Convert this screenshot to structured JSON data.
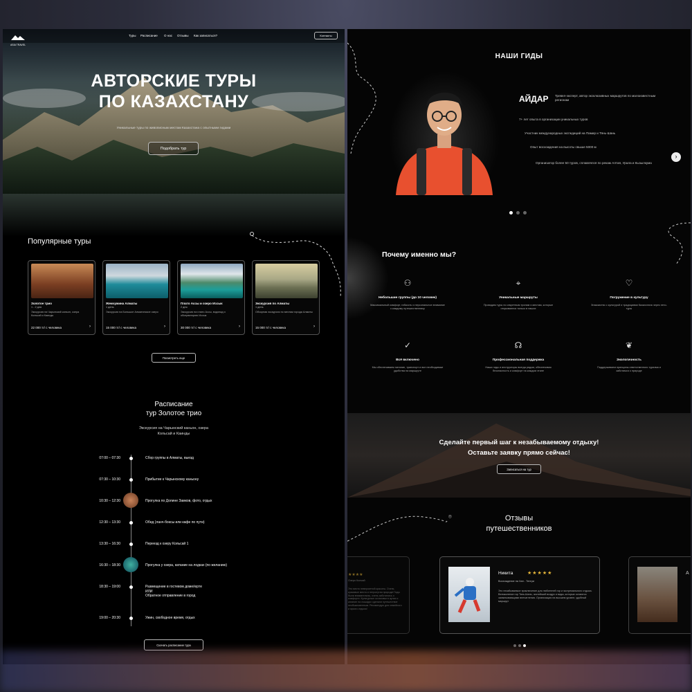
{
  "brand": {
    "name": "ASIA TRAVEL"
  },
  "nav": {
    "items": [
      "Туры",
      "Расписание",
      "О нас",
      "Отзывы",
      "Как записаться?"
    ],
    "contacts": "Контакты"
  },
  "hero": {
    "title_line1": "АВТОРСКИЕ ТУРЫ",
    "title_line2": "ПО КАЗАХСТАНУ",
    "subtitle": "Уникальные туры по живописным местам Казахстана с опытными гидами",
    "cta": "Подобрать тур"
  },
  "popular": {
    "title": "Популярные туры",
    "more": "Посмотреть еще",
    "cards": [
      {
        "title": "Золотое трио",
        "duration": "1 - 2 дня",
        "desc": "Экскурсия на Чарынский каньон, озера Кольсай и Каинды",
        "price": "22 000 тг/ с человека"
      },
      {
        "title": "Жемчужина Алматы",
        "duration": "1 день",
        "desc": "Экскурсия на Большое Алматинское озеро",
        "price": "15 000 тг/ с человека"
      },
      {
        "title": "Плато Ассы и озеро Иссык",
        "duration": "2 дня",
        "desc": "Экскурсия на плато Ассы, водопад и обсерваторию Иссык",
        "price": "30 000 тг/ с человека"
      },
      {
        "title": "Экскурсия по Алматы",
        "duration": "1 день",
        "desc": "Обзорная экскурсия по местам города Алматы",
        "price": "15 000 тг/ с человека"
      }
    ]
  },
  "schedule": {
    "title_line1": "Расписание",
    "title_line2": "тур Золотое трио",
    "subtitle_line1": "Экскурсия на Чарынский каньон, озера",
    "subtitle_line2": "Кольсай и Каинды",
    "download": "Скачать расписание тура",
    "items": [
      {
        "time": "07:00 – 07:30",
        "text": "Сбор группы в Алматы, выезд"
      },
      {
        "time": "07:30 – 10:30",
        "text": "Прибытие к Чарынскому каньону"
      },
      {
        "time": "10:30 – 12:30",
        "text": "Прогулка по Долине Замков, фото, отдых"
      },
      {
        "time": "12:30 – 13:30",
        "text": "Обед (ланч-боксы или кафе по пути)"
      },
      {
        "time": "13:30 – 16:30",
        "text": "Переезд к озеру Кольсай 1"
      },
      {
        "time": "16:30 – 18:30",
        "text": "Прогулка у озера, катание на лодках (по желанию)"
      },
      {
        "time": "18:30 – 19:00",
        "text": "Размещение в гостевом доме/юрте",
        "text2": "ИЛИ",
        "text3": "Обратное отправление в город"
      },
      {
        "time": "19:00 – 20:30",
        "text": "Ужин, свободное время, отдых"
      }
    ]
  },
  "guides": {
    "title": "НАШИ ГИДЫ",
    "name": "АЙДАР",
    "role": "Тревел-эксперт, автор эксклюзивных маршрутов по малоизвестным регионам",
    "facts": [
      "7+ лет опыта в организации уникальных туров",
      "Участник международных экспедиций на Памир и Тянь-Шань",
      "Опыт восхождения на высоты свыше 5000 м",
      "Организатор более 50 туров, сплавлялся по рекам Алтая, Урала и Кызылкума"
    ]
  },
  "why": {
    "title": "Почему именно мы?",
    "features": [
      {
        "icon": "group-icon",
        "title": "Небольшие группы (до 10 человек)",
        "desc": "Максимальный комфорт, гибкость и персональное внимание к каждому путешественнику"
      },
      {
        "icon": "map-icon",
        "title": "Уникальные маршруты",
        "desc": "Проводим туры по секретным тропам и местам, которые открываются только в наших"
      },
      {
        "icon": "heart-icon",
        "title": "Погружение в культуру",
        "desc": "Знакомство с культурой и традициями Казахстана через этно-туры"
      },
      {
        "icon": "check-icon",
        "title": "Всё включено",
        "desc": "Мы обеспечиваем питание, транспорт и все необходимые удобства на маршруте"
      },
      {
        "icon": "headset-icon",
        "title": "Профессиональная поддержка",
        "desc": "Наши гиды и инструкторы всегда рядом, обеспечивая безопасность и комфорт на каждом этапе"
      },
      {
        "icon": "eco-icon",
        "title": "Экологичность",
        "desc": "Поддерживаем принципы ответственного туризма и заботимся о природе"
      }
    ]
  },
  "cta": {
    "line1": "Сделайте первый шаг к незабываемому отдыху!",
    "line2": "Оставьте заявку прямо сейчас!",
    "button": "Записаться на тур"
  },
  "reviews": {
    "title_line1": "Отзывы",
    "title_line2": "путешественников",
    "main": {
      "name": "Никита",
      "stars": "★★★★★",
      "route": "Восхождение на Хан - Тенгри",
      "text": "Это незабываемое приключение для любителей гор и экстремального отдыха. Великолепие гор Тянь-Шань, чистейший воздух и виды, которые остаются захватывающими впечатления. Организация на высшем уровне, удобный маршрут"
    },
    "left": {
      "stars": "★★★★",
      "route": "Озеро Колсай",
      "text": "Это место невероятной красоты. Очень красивые места и нетронутая природа! Гиды были внимательны, очень заботились о комфорте. Культурные остановки в аулах и катание на лошадях сделали путешествие необыкновенным. Рекомендую для семейного и яркого отдыха!"
    },
    "right": {
      "initial": "А"
    }
  }
}
